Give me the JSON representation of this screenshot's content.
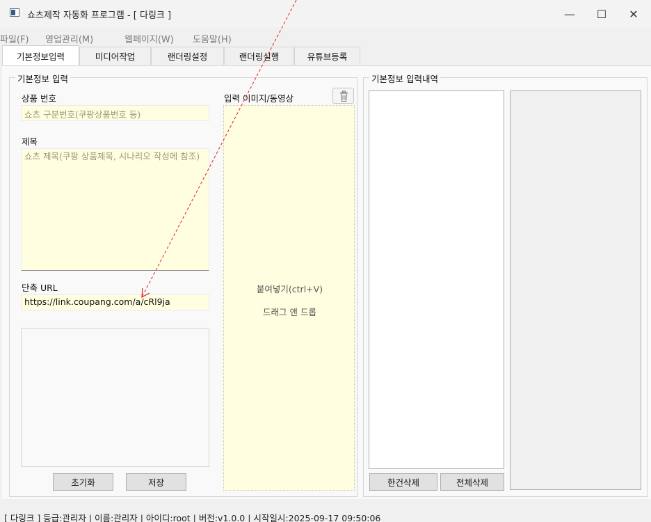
{
  "window": {
    "title": "쇼츠제작 자동화 프로그램 - [ 다링크 ]",
    "controls": {
      "minimize": "—",
      "maximize": "☐",
      "close": "✕"
    }
  },
  "menu": [
    "파일(F)",
    "영업관리(M)",
    "웹페이지(W)",
    "도움말(H)"
  ],
  "tabs": [
    "기본정보입력",
    "미디어작업",
    "랜더링설정",
    "랜더링실행",
    "유튜브등록"
  ],
  "active_tab": "기본정보입력",
  "basic_info": {
    "group_title": "기본정보 입력",
    "product_no_label": "상품 번호",
    "product_no_placeholder": "쇼츠 구분번호(쿠팡상품번호 등)",
    "title_label": "제목",
    "title_placeholder": "쇼츠 제목(쿠팡 상품제목, 시나리오 작성에 참조)",
    "short_url_label": "단축 URL",
    "short_url_value": "https://link.coupang.com/a/cRl9ja",
    "reset_button": "초기화",
    "save_button": "저장"
  },
  "media_input": {
    "label": "입력 이미지/동영상",
    "paste_hint": "붙여넣기(ctrl+V)",
    "drag_hint": "드래그 앤 드롭"
  },
  "history": {
    "group_title": "기본정보 입력내역",
    "delete_one_button": "한건삭제",
    "delete_all_button": "전체삭제"
  },
  "status_bar": "[ 다링크 ] 등급:관리자 | 이름:관리자 | 아이디:root | 버전:v1.0.0 | 시작일시:2025-09-17 09:50:06",
  "colors": {
    "input_background": "#fffee0",
    "annotation_arrow": "#e02020"
  },
  "icons": {
    "trash": "trash-icon",
    "app": "app-icon"
  }
}
